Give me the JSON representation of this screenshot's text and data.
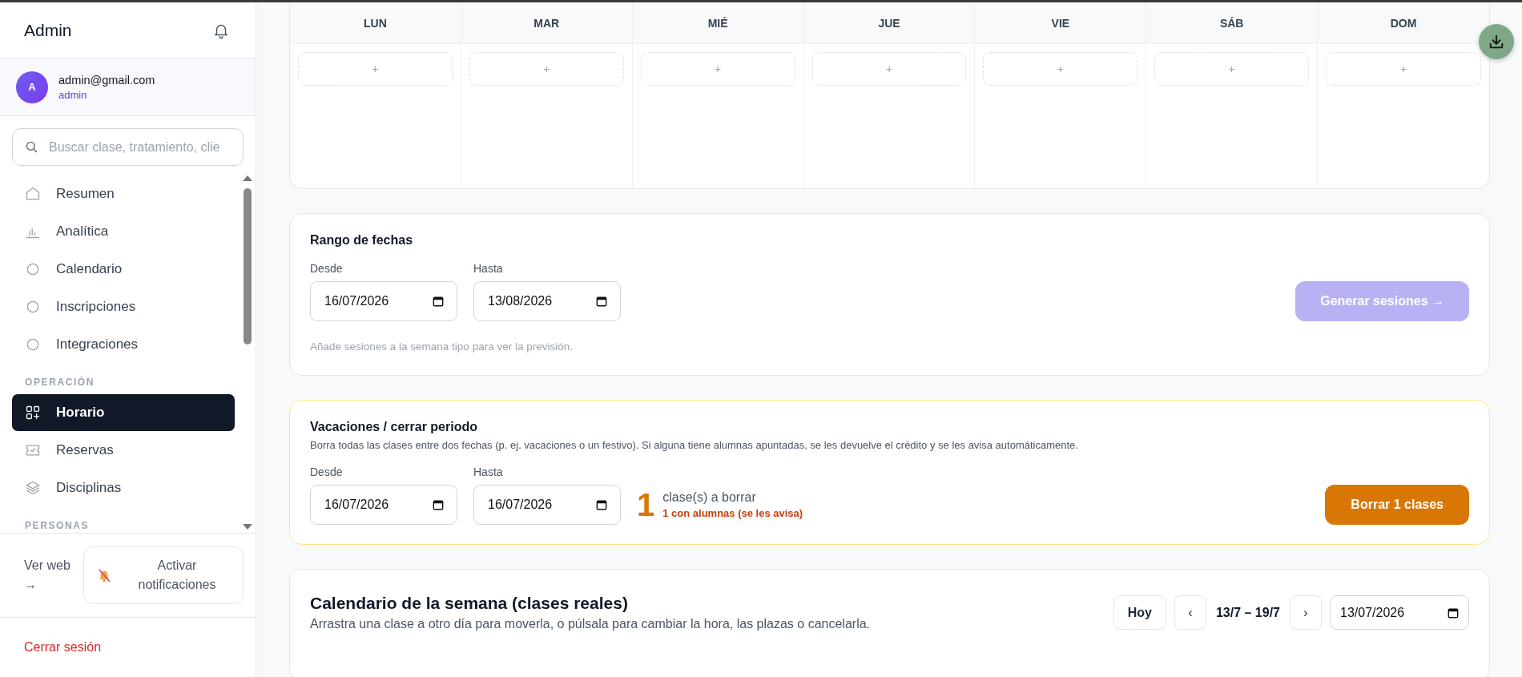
{
  "sidebar": {
    "title": "Admin",
    "user": {
      "initial": "A",
      "email": "admin@gmail.com",
      "role": "admin"
    },
    "search": {
      "placeholder": "Buscar clase, tratamiento, clie"
    },
    "nav": [
      {
        "kind": "item",
        "label": "Resumen",
        "selected": false
      },
      {
        "kind": "item",
        "label": "Analítica",
        "selected": false
      },
      {
        "kind": "item",
        "label": "Calendario",
        "selected": false
      },
      {
        "kind": "item",
        "label": "Inscripciones",
        "selected": false
      },
      {
        "kind": "item",
        "label": "Integraciones",
        "selected": false
      },
      {
        "kind": "section",
        "label": "OPERACIÓN"
      },
      {
        "kind": "item",
        "label": "Horario",
        "selected": true
      },
      {
        "kind": "item",
        "label": "Reservas",
        "selected": false
      },
      {
        "kind": "item",
        "label": "Disciplinas",
        "selected": false
      },
      {
        "kind": "section",
        "label": "PERSONAS"
      }
    ],
    "web_link": "Ver web →",
    "notify_button": "Activar notificaciones",
    "logout": "Cerrar sesión"
  },
  "week_template": {
    "days": [
      {
        "label": "LUN",
        "add": "+"
      },
      {
        "label": "MAR",
        "add": "+"
      },
      {
        "label": "MIÉ",
        "add": "+"
      },
      {
        "label": "JUE",
        "add": "+"
      },
      {
        "label": "VIE",
        "add": "+"
      },
      {
        "label": "SÁB",
        "add": "+"
      },
      {
        "label": "DOM",
        "add": "+"
      }
    ]
  },
  "date_range": {
    "title": "Rango de fechas",
    "fields": [
      {
        "label": "Desde",
        "value": "16/07/2026"
      },
      {
        "label": "Hasta",
        "value": "13/08/2026"
      }
    ],
    "hint": "Añade sesiones a la semana tipo para ver la previsión.",
    "button": {
      "label": "Generar sesiones →",
      "disabled": true
    }
  },
  "vacation": {
    "title": "Vacaciones / cerrar periodo",
    "description": "Borra todas las clases entre dos fechas (p. ej. vacaciones o un festivo). Si alguna tiene alumnas apuntadas, se les devuelve el crédito y se les avisa automáticamente.",
    "fields": [
      {
        "label": "Desde",
        "value": "16/07/2026"
      },
      {
        "label": "Hasta",
        "value": "16/07/2026"
      }
    ],
    "count": "1",
    "count_label": "clase(s) a borrar",
    "warning": "1 con alumnas (se les avisa)",
    "button": {
      "label": "Borrar 1 clases",
      "disabled": false
    }
  },
  "week_calendar": {
    "title": "Calendario de la semana (clases reales)",
    "subtitle": "Arrastra una clase a otro día para moverla, o púlsala para cambiar la hora, las plazas o cancelarla.",
    "today_button": "Hoy",
    "prev": "‹",
    "range": "13/7 – 19/7",
    "next": "›",
    "date": "13/07/2026"
  }
}
